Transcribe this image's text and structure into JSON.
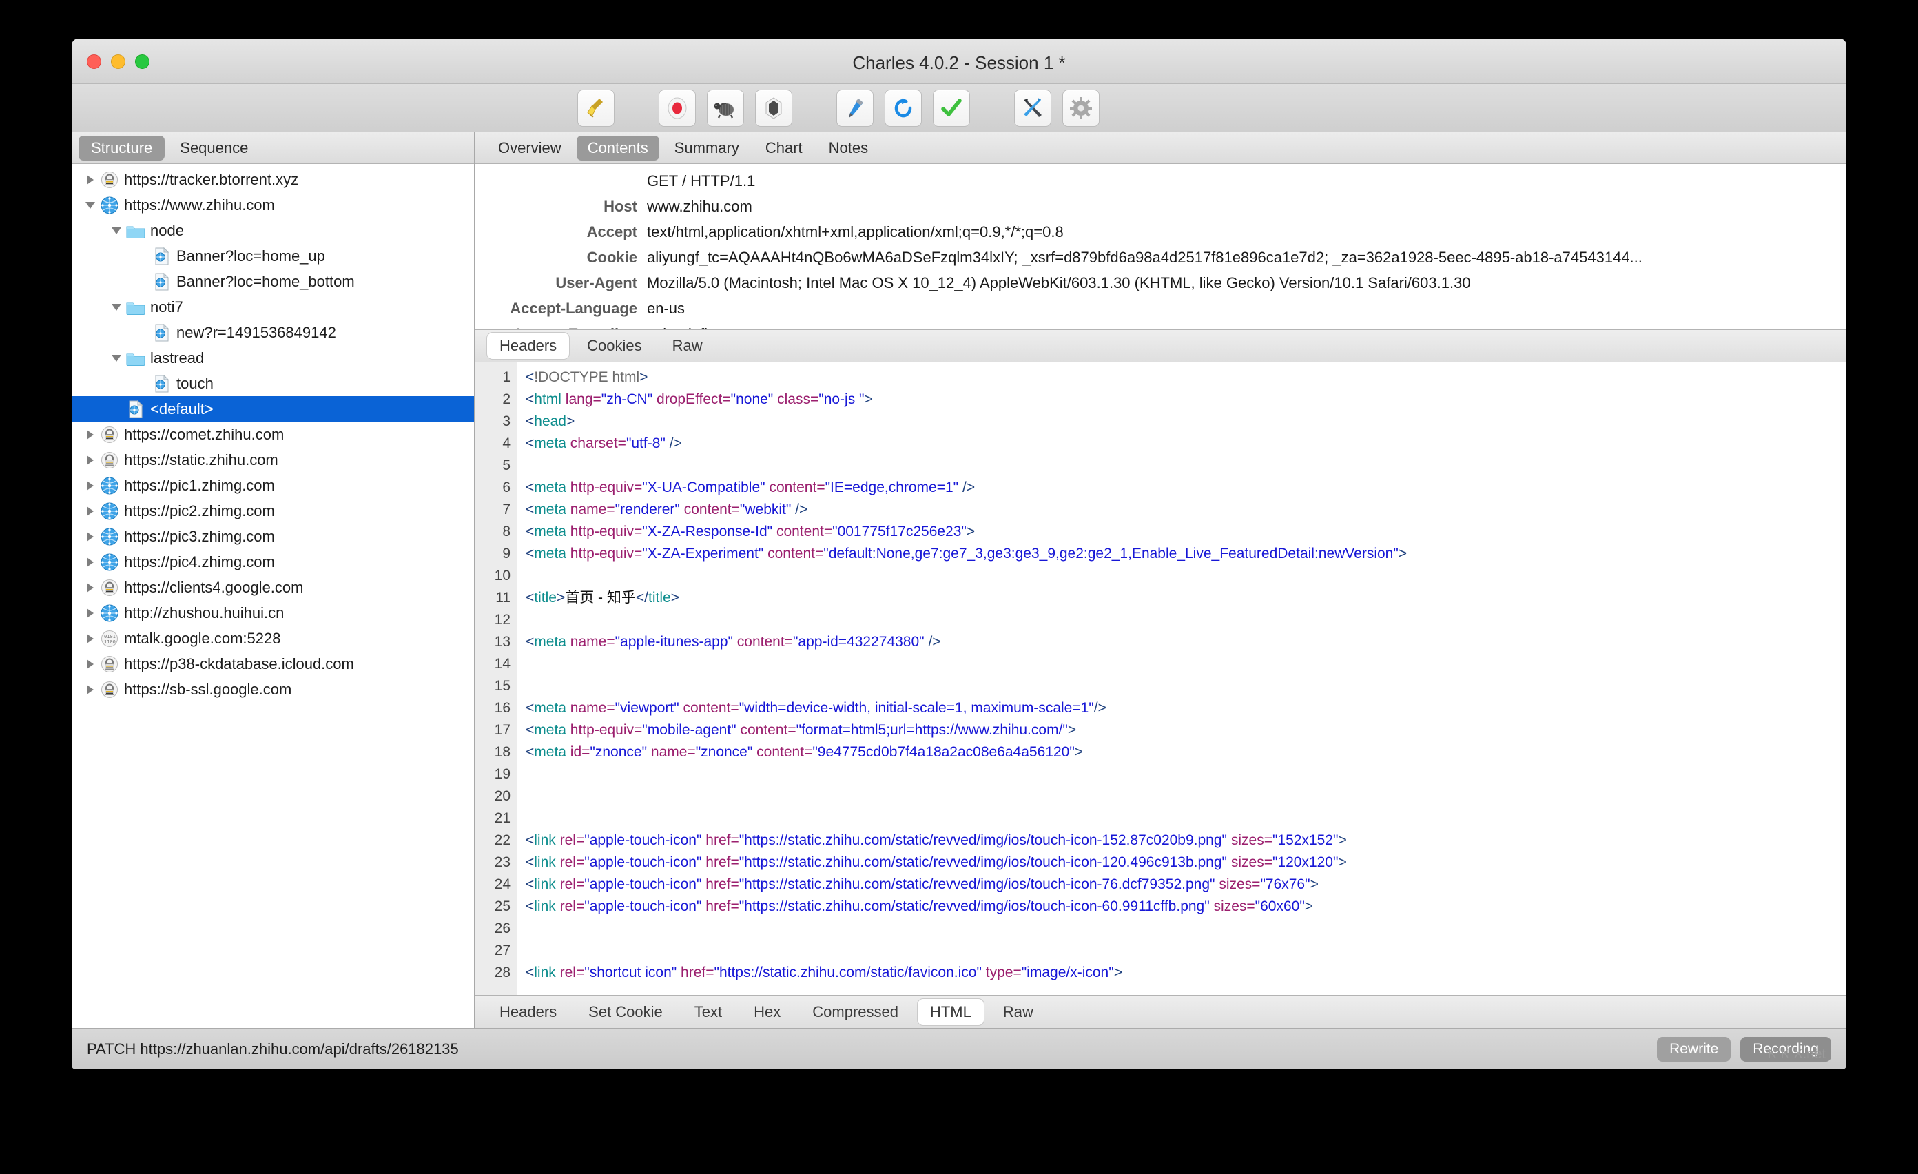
{
  "window": {
    "title": "Charles 4.0.2 - Session 1 *",
    "traffic_lights": [
      "close",
      "minimize",
      "maximize"
    ]
  },
  "toolbar": {
    "buttons": [
      {
        "name": "clear-session",
        "icon": "broom-icon"
      },
      {
        "name": "start-stop-recording",
        "icon": "record-icon"
      },
      {
        "name": "throttle-settings",
        "icon": "turtle-icon"
      },
      {
        "name": "breakpoint-settings",
        "icon": "shield-icon"
      },
      {
        "name": "compose",
        "icon": "pen-icon"
      },
      {
        "name": "repeat",
        "icon": "refresh-icon"
      },
      {
        "name": "validate",
        "icon": "checkmark-icon"
      },
      {
        "name": "tools",
        "icon": "tools-icon"
      },
      {
        "name": "settings",
        "icon": "gear-icon"
      }
    ]
  },
  "sidebar": {
    "segments": [
      {
        "label": "Structure",
        "selected": true
      },
      {
        "label": "Sequence",
        "selected": false
      }
    ],
    "tree": [
      {
        "label": "https://tracker.btorrent.xyz",
        "indent": 0,
        "arrow": "right",
        "icon": "lock-icon",
        "selected": false
      },
      {
        "label": "https://www.zhihu.com",
        "indent": 0,
        "arrow": "down",
        "icon": "globe-icon",
        "selected": false
      },
      {
        "label": "node",
        "indent": 1,
        "arrow": "down",
        "icon": "folder-icon",
        "selected": false
      },
      {
        "label": "Banner?loc=home_up",
        "indent": 2,
        "arrow": "none",
        "icon": "document-icon",
        "selected": false
      },
      {
        "label": "Banner?loc=home_bottom",
        "indent": 2,
        "arrow": "none",
        "icon": "document-icon",
        "selected": false
      },
      {
        "label": "noti7",
        "indent": 1,
        "arrow": "down",
        "icon": "folder-icon",
        "selected": false
      },
      {
        "label": "new?r=1491536849142",
        "indent": 2,
        "arrow": "none",
        "icon": "document-icon",
        "selected": false
      },
      {
        "label": "lastread",
        "indent": 1,
        "arrow": "down",
        "icon": "folder-icon",
        "selected": false
      },
      {
        "label": "touch",
        "indent": 2,
        "arrow": "none",
        "icon": "document-icon",
        "selected": false
      },
      {
        "label": "<default>",
        "indent": 1,
        "arrow": "none",
        "icon": "document-icon",
        "selected": true
      },
      {
        "label": "https://comet.zhihu.com",
        "indent": 0,
        "arrow": "right",
        "icon": "lock-icon",
        "selected": false
      },
      {
        "label": "https://static.zhihu.com",
        "indent": 0,
        "arrow": "right",
        "icon": "lock-icon",
        "selected": false
      },
      {
        "label": "https://pic1.zhimg.com",
        "indent": 0,
        "arrow": "right",
        "icon": "globe-icon",
        "selected": false
      },
      {
        "label": "https://pic2.zhimg.com",
        "indent": 0,
        "arrow": "right",
        "icon": "globe-icon",
        "selected": false
      },
      {
        "label": "https://pic3.zhimg.com",
        "indent": 0,
        "arrow": "right",
        "icon": "globe-icon",
        "selected": false
      },
      {
        "label": "https://pic4.zhimg.com",
        "indent": 0,
        "arrow": "right",
        "icon": "globe-icon",
        "selected": false
      },
      {
        "label": "https://clients4.google.com",
        "indent": 0,
        "arrow": "right",
        "icon": "lock-icon",
        "selected": false
      },
      {
        "label": "http://zhushou.huihui.cn",
        "indent": 0,
        "arrow": "right",
        "icon": "globe-icon",
        "selected": false
      },
      {
        "label": "mtalk.google.com:5228",
        "indent": 0,
        "arrow": "right",
        "icon": "socket-icon",
        "selected": false
      },
      {
        "label": "https://p38-ckdatabase.icloud.com",
        "indent": 0,
        "arrow": "right",
        "icon": "lock-icon",
        "selected": false
      },
      {
        "label": "https://sb-ssl.google.com",
        "indent": 0,
        "arrow": "right",
        "icon": "lock-icon",
        "selected": false
      }
    ]
  },
  "main": {
    "tabs_top": [
      {
        "label": "Overview",
        "selected": false
      },
      {
        "label": "Contents",
        "selected": true
      },
      {
        "label": "Summary",
        "selected": false
      },
      {
        "label": "Chart",
        "selected": false
      },
      {
        "label": "Notes",
        "selected": false
      }
    ],
    "tabs_mid": [
      {
        "label": "Headers",
        "selected": true
      },
      {
        "label": "Cookies",
        "selected": false
      },
      {
        "label": "Raw",
        "selected": false
      }
    ],
    "tabs_bottom": [
      {
        "label": "Headers",
        "selected": false
      },
      {
        "label": "Set Cookie",
        "selected": false
      },
      {
        "label": "Text",
        "selected": false
      },
      {
        "label": "Hex",
        "selected": false
      },
      {
        "label": "Compressed",
        "selected": false
      },
      {
        "label": "HTML",
        "selected": true
      },
      {
        "label": "Raw",
        "selected": false
      }
    ],
    "headers": [
      {
        "name": "",
        "value": "GET / HTTP/1.1"
      },
      {
        "name": "Host",
        "value": "www.zhihu.com"
      },
      {
        "name": "Accept",
        "value": "text/html,application/xhtml+xml,application/xml;q=0.9,*/*;q=0.8"
      },
      {
        "name": "Cookie",
        "value": "aliyungf_tc=AQAAAHt4nQBo6wMA6aDSeFzqlm34lxIY; _xsrf=d879bfd6a98a4d2517f81e896ca1e7d2; _za=362a1928-5eec-4895-ab18-a74543144..."
      },
      {
        "name": "User-Agent",
        "value": "Mozilla/5.0 (Macintosh; Intel Mac OS X 10_12_4) AppleWebKit/603.1.30 (KHTML, like Gecko) Version/10.1 Safari/603.1.30"
      },
      {
        "name": "Accept-Language",
        "value": "en-us"
      },
      {
        "name": "Accept-Encoding",
        "value": "gzip, deflate"
      }
    ],
    "code_lines": [
      {
        "n": 1,
        "text": "<!DOCTYPE html>"
      },
      {
        "n": 2,
        "text": "<html lang=\"zh-CN\" dropEffect=\"none\" class=\"no-js \">"
      },
      {
        "n": 3,
        "text": "<head>"
      },
      {
        "n": 4,
        "text": "<meta charset=\"utf-8\" />"
      },
      {
        "n": 5,
        "text": ""
      },
      {
        "n": 6,
        "text": "<meta http-equiv=\"X-UA-Compatible\" content=\"IE=edge,chrome=1\" />"
      },
      {
        "n": 7,
        "text": "<meta name=\"renderer\" content=\"webkit\" />"
      },
      {
        "n": 8,
        "text": "<meta http-equiv=\"X-ZA-Response-Id\" content=\"001775f17c256e23\">"
      },
      {
        "n": 9,
        "text": "<meta http-equiv=\"X-ZA-Experiment\" content=\"default:None,ge7:ge7_3,ge3:ge3_9,ge2:ge2_1,Enable_Live_FeaturedDetail:newVersion\">"
      },
      {
        "n": 10,
        "text": ""
      },
      {
        "n": 11,
        "text": "<title>首页 - 知乎</title>"
      },
      {
        "n": 12,
        "text": ""
      },
      {
        "n": 13,
        "text": "<meta name=\"apple-itunes-app\" content=\"app-id=432274380\" />"
      },
      {
        "n": 14,
        "text": ""
      },
      {
        "n": 15,
        "text": ""
      },
      {
        "n": 16,
        "text": "<meta name=\"viewport\" content=\"width=device-width, initial-scale=1, maximum-scale=1\"/>"
      },
      {
        "n": 17,
        "text": "<meta http-equiv=\"mobile-agent\" content=\"format=html5;url=https://www.zhihu.com/\">"
      },
      {
        "n": 18,
        "text": "<meta id=\"znonce\" name=\"znonce\" content=\"9e4775cd0b7f4a18a2ac08e6a4a56120\">"
      },
      {
        "n": 19,
        "text": ""
      },
      {
        "n": 20,
        "text": ""
      },
      {
        "n": 21,
        "text": ""
      },
      {
        "n": 22,
        "text": "<link rel=\"apple-touch-icon\" href=\"https://static.zhihu.com/static/revved/img/ios/touch-icon-152.87c020b9.png\" sizes=\"152x152\">"
      },
      {
        "n": 23,
        "text": "<link rel=\"apple-touch-icon\" href=\"https://static.zhihu.com/static/revved/img/ios/touch-icon-120.496c913b.png\" sizes=\"120x120\">"
      },
      {
        "n": 24,
        "text": "<link rel=\"apple-touch-icon\" href=\"https://static.zhihu.com/static/revved/img/ios/touch-icon-76.dcf79352.png\" sizes=\"76x76\">"
      },
      {
        "n": 25,
        "text": "<link rel=\"apple-touch-icon\" href=\"https://static.zhihu.com/static/revved/img/ios/touch-icon-60.9911cffb.png\" sizes=\"60x60\">"
      },
      {
        "n": 26,
        "text": ""
      },
      {
        "n": 27,
        "text": ""
      },
      {
        "n": 28,
        "text": "<link rel=\"shortcut icon\" href=\"https://static.zhihu.com/static/favicon.ico\" type=\"image/x-icon\">"
      }
    ]
  },
  "status": {
    "text": "PATCH https://zhuanlan.zhihu.com/api/drafts/26182135",
    "buttons": [
      {
        "label": "Rewrite",
        "active": false
      },
      {
        "label": "Recording",
        "active": true
      }
    ]
  },
  "watermark": "K K X.net",
  "colors": {
    "selection": "#0a63d6",
    "tag": "#0d8d8d",
    "attr": "#9b1f6e",
    "value": "#1717d6",
    "bracket": "#20427f",
    "toolbar_bg": "#d6d6d6"
  }
}
